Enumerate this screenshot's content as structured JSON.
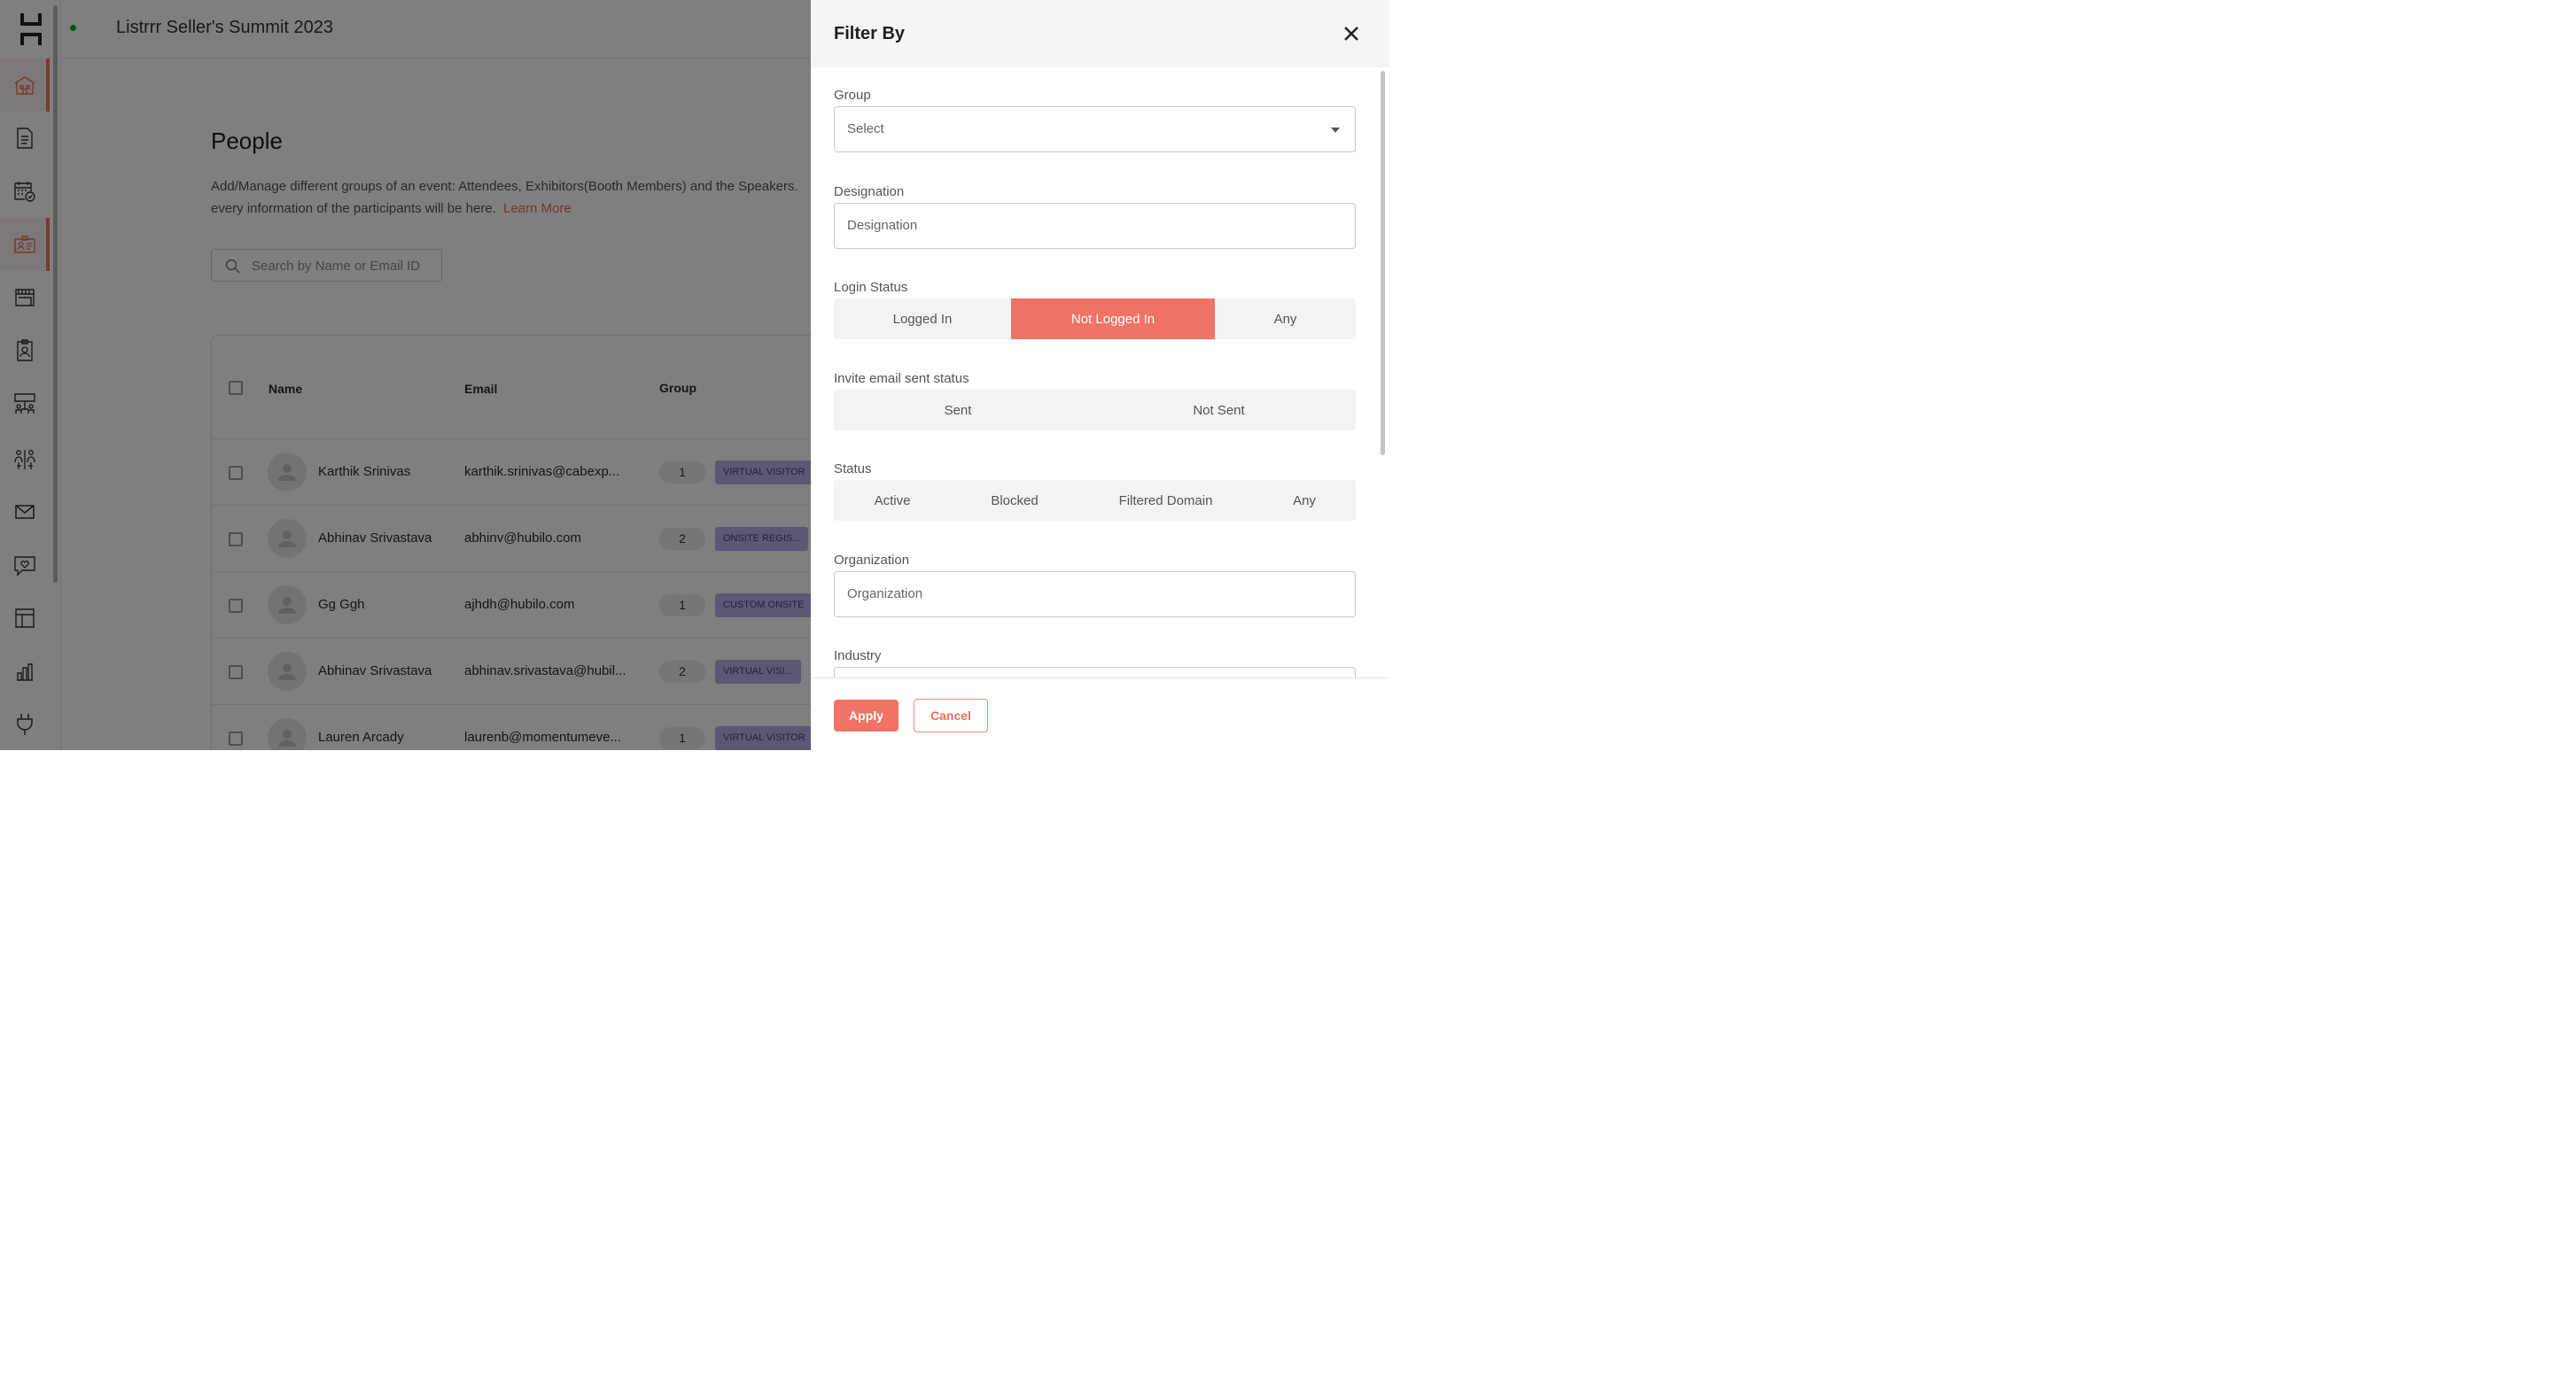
{
  "header": {
    "event_title": "Listrrr Seller's Summit 2023"
  },
  "sidebar": {
    "items": [
      {
        "icon": "venue-icon",
        "active": true
      },
      {
        "icon": "document-icon",
        "active": false
      },
      {
        "icon": "calendar-icon",
        "active": false
      },
      {
        "icon": "people-card-icon",
        "active": true
      },
      {
        "icon": "booth-icon",
        "active": false
      },
      {
        "icon": "badge-icon",
        "active": false
      },
      {
        "icon": "lounge-icon",
        "active": false
      },
      {
        "icon": "networking-icon",
        "active": false
      },
      {
        "icon": "mail-icon",
        "active": false
      },
      {
        "icon": "engagement-icon",
        "active": false
      },
      {
        "icon": "layout-icon",
        "active": false
      },
      {
        "icon": "analytics-icon",
        "active": false
      },
      {
        "icon": "integrations-icon",
        "active": false
      }
    ]
  },
  "main": {
    "title": "People",
    "description_line1": "Add/Manage different groups of an event: Attendees, Exhibitors(Booth Members) and the Speakers.",
    "description_line2": "every information of the participants will be here.",
    "learn_more": "Learn More",
    "search_placeholder": "Search by Name or Email ID",
    "table": {
      "columns": [
        "Name",
        "Email",
        "Group"
      ],
      "rows": [
        {
          "name": "Karthik Srinivas",
          "email": "karthik.srinivas@cabexp...",
          "count": "1",
          "group": "VIRTUAL VISITOR"
        },
        {
          "name": "Abhinav Srivastava",
          "email": "abhinv@hubilo.com",
          "count": "2",
          "group": "ONSITE REGIS..."
        },
        {
          "name": "Gg Ggh",
          "email": "ajhdh@hubilo.com",
          "count": "1",
          "group": "CUSTOM ONSITE"
        },
        {
          "name": "Abhinav Srivastava",
          "email": "abhinav.srivastava@hubil...",
          "count": "2",
          "group": "VIRTUAL VISI..."
        },
        {
          "name": "Lauren Arcady",
          "email": "laurenb@momentumeve...",
          "count": "1",
          "group": "VIRTUAL VISITOR"
        }
      ]
    }
  },
  "filter": {
    "title": "Filter By",
    "group": {
      "label": "Group",
      "value": "Select"
    },
    "designation": {
      "label": "Designation",
      "placeholder": "Designation"
    },
    "login_status": {
      "label": "Login Status",
      "options": [
        "Logged In",
        "Not Logged In",
        "Any"
      ],
      "selected": "Not Logged In"
    },
    "invite_status": {
      "label": "Invite email sent status",
      "options": [
        "Sent",
        "Not Sent"
      ]
    },
    "status": {
      "label": "Status",
      "options": [
        "Active",
        "Blocked",
        "Filtered Domain",
        "Any"
      ]
    },
    "organization": {
      "label": "Organization",
      "placeholder": "Organization"
    },
    "industry": {
      "label": "Industry"
    },
    "apply": "Apply",
    "cancel": "Cancel"
  },
  "colors": {
    "accent": "#ef7466",
    "badge": "#b9b0e8",
    "online": "#19a34a"
  }
}
